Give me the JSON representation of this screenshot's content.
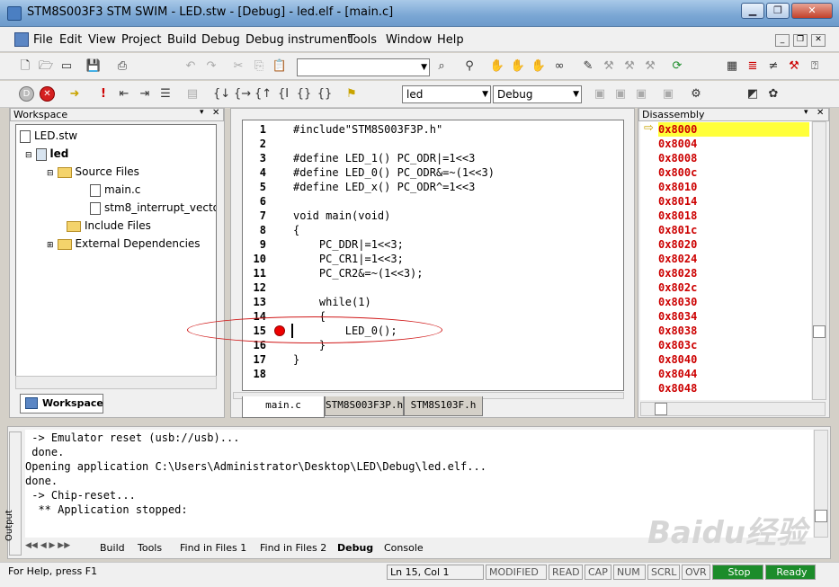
{
  "window": {
    "title": "STM8S003F3 STM SWIM - LED.stw - [Debug] - led.elf - [main.c]"
  },
  "menu": [
    "File",
    "Edit",
    "View",
    "Project",
    "Build",
    "Debug",
    "Debug instrument",
    "Tools",
    "Window",
    "Help"
  ],
  "toolbar": {
    "project_combo": "led",
    "config_combo": "Debug",
    "search_combo": ""
  },
  "workspace": {
    "title": "Workspace",
    "tab": "Workspace",
    "tree": [
      "LED.stw",
      "led",
      "Source Files",
      "main.c",
      "stm8_interrupt_vecto",
      "Include Files",
      "External Dependencies"
    ]
  },
  "editor": {
    "lines": [
      {
        "n": "1",
        "text": "#include\"STM8S003F3P.h\""
      },
      {
        "n": "2",
        "text": ""
      },
      {
        "n": "3",
        "text": "#define LED_1() PC_ODR|=1<<3"
      },
      {
        "n": "4",
        "text": "#define LED_0() PC_ODR&=~(1<<3)"
      },
      {
        "n": "5",
        "text": "#define LED_x() PC_ODR^=1<<3"
      },
      {
        "n": "6",
        "text": ""
      },
      {
        "n": "7",
        "text": "void main(void)"
      },
      {
        "n": "8",
        "text": "{"
      },
      {
        "n": "9",
        "text": "    PC_DDR|=1<<3;"
      },
      {
        "n": "10",
        "text": "    PC_CR1|=1<<3;"
      },
      {
        "n": "11",
        "text": "    PC_CR2&=~(1<<3);"
      },
      {
        "n": "12",
        "text": ""
      },
      {
        "n": "13",
        "text": "    while(1)"
      },
      {
        "n": "14",
        "text": "    {"
      },
      {
        "n": "15",
        "text": "        LED_0();"
      },
      {
        "n": "16",
        "text": "    }"
      },
      {
        "n": "17",
        "text": "}"
      },
      {
        "n": "18",
        "text": ""
      }
    ],
    "tabs": [
      "main.c",
      "STM8S003F3P.h",
      "STM8S103F.h"
    ]
  },
  "disassembly": {
    "title": "Disassembly",
    "addresses": [
      "0x8000",
      "0x8004",
      "0x8008",
      "0x800c",
      "0x8010",
      "0x8014",
      "0x8018",
      "0x801c",
      "0x8020",
      "0x8024",
      "0x8028",
      "0x802c",
      "0x8030",
      "0x8034",
      "0x8038",
      "0x803c",
      "0x8040",
      "0x8044",
      "0x8048"
    ]
  },
  "output": {
    "label": "Output",
    "lines": [
      " -> Emulator reset (usb://usb)...",
      " done.",
      "Opening application C:\\Users\\Administrator\\Desktop\\LED\\Debug\\led.elf...",
      "done.",
      " -> Chip-reset...",
      "  ** Application stopped:"
    ],
    "tabs": [
      "Build",
      "Tools",
      "Find in Files 1",
      "Find in Files 2",
      "Debug",
      "Console"
    ]
  },
  "status": {
    "help": "For Help, press F1",
    "pos": "Ln 15, Col 1",
    "modified": "MODIFIED",
    "read": "READ",
    "cap": "CAP",
    "num": "NUM",
    "scrl": "SCRL",
    "ovr": "OVR",
    "stop": "Stop",
    "ready": "Ready"
  },
  "watermark": "Baidu经验"
}
